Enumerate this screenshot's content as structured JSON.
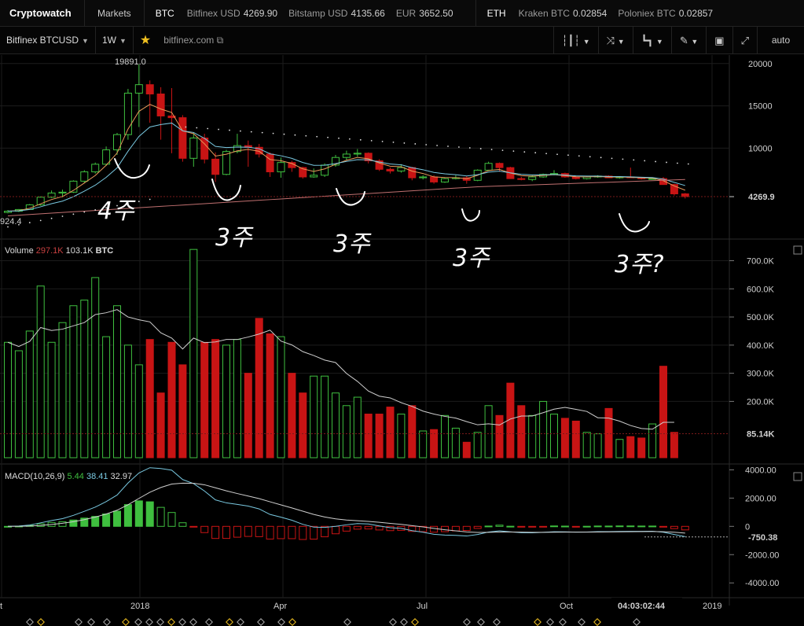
{
  "app": {
    "brand": "Cryptowatch",
    "markets": "Markets"
  },
  "ticker": {
    "btc": {
      "symbol": "BTC",
      "items": [
        {
          "label": "Bitfinex USD",
          "value": "4269.90"
        },
        {
          "label": "Bitstamp USD",
          "value": "4135.66"
        },
        {
          "label": "EUR",
          "value": "3652.50"
        }
      ]
    },
    "eth": {
      "symbol": "ETH",
      "items": [
        {
          "label": "Kraken BTC",
          "value": "0.02854"
        },
        {
          "label": "Poloniex BTC",
          "value": "0.02857"
        }
      ]
    }
  },
  "toolbar": {
    "market": "Bitfinex BTCUSD",
    "period": "1W",
    "host": "bitfinex.com",
    "auto": "auto"
  },
  "price_pane": {
    "y_ticks": [
      "20000",
      "15000",
      "10000"
    ],
    "last_price": "4269.9",
    "high_label": "19891.0",
    "low_label": "924.4"
  },
  "volume_pane": {
    "title": "Volume",
    "current": "297.1K",
    "avg": "103.1K",
    "unit": "BTC",
    "y_ticks": [
      "700.0K",
      "600.0K",
      "500.0K",
      "400.0K",
      "300.0K",
      "200.0K"
    ],
    "last_value": "85.14K"
  },
  "macd_pane": {
    "title": "MACD(10,26,9)",
    "v1": "5.44",
    "v2": "38.41",
    "v3": "32.97",
    "y_ticks": [
      "4000.00",
      "2000.00",
      "0",
      "-2000.00",
      "-4000.00"
    ],
    "last_value": "-750.38"
  },
  "time_axis": {
    "labels": [
      "t",
      "2018",
      "Apr",
      "Jul",
      "Oct",
      "2019"
    ],
    "cursor_time": "04:03:02:44"
  },
  "annotations": [
    "4주",
    "3주",
    "3주",
    "3주",
    "3주?"
  ],
  "colors": {
    "up": "#3fbf3f",
    "down": "#c81414",
    "ema_fast": "#e89a5a",
    "ema_slow": "#79c8e0",
    "sma_long": "#c07070",
    "accent": "#f0c020"
  },
  "chart_data": {
    "type": "candlestick",
    "candles_ohlc": [
      [
        2400,
        2700,
        2300,
        2550
      ],
      [
        2550,
        2800,
        2450,
        2750
      ],
      [
        2750,
        3400,
        2700,
        3300
      ],
      [
        3300,
        4300,
        3200,
        4200
      ],
      [
        4200,
        5000,
        4100,
        4700
      ],
      [
        4700,
        5100,
        4200,
        4800
      ],
      [
        4800,
        6200,
        4700,
        6100
      ],
      [
        6100,
        7400,
        5900,
        7200
      ],
      [
        7200,
        8300,
        7000,
        8100
      ],
      [
        8100,
        10200,
        7900,
        9800
      ],
      [
        9800,
        11800,
        9200,
        11600
      ],
      [
        11600,
        17000,
        11000,
        16500
      ],
      [
        16500,
        19891,
        12500,
        17500
      ],
      [
        17500,
        18000,
        13000,
        16400
      ],
      [
        16400,
        17200,
        11000,
        13800
      ],
      [
        13800,
        17100,
        9400,
        13600
      ],
      [
        13600,
        13900,
        8400,
        8800
      ],
      [
        8800,
        11800,
        7800,
        11200
      ],
      [
        11200,
        11700,
        8200,
        8700
      ],
      [
        8700,
        9500,
        6000,
        6900
      ],
      [
        6900,
        9800,
        6800,
        9600
      ],
      [
        9600,
        11700,
        9400,
        10300
      ],
      [
        10300,
        10900,
        7800,
        10100
      ],
      [
        10100,
        10500,
        8900,
        9300
      ],
      [
        9300,
        9500,
        6600,
        7200
      ],
      [
        7200,
        8900,
        6500,
        8300
      ],
      [
        8300,
        8500,
        7200,
        7700
      ],
      [
        7700,
        7800,
        6400,
        6600
      ],
      [
        6600,
        7600,
        6500,
        6800
      ],
      [
        6800,
        8200,
        6600,
        8000
      ],
      [
        8000,
        9200,
        7800,
        8900
      ],
      [
        8900,
        9700,
        8600,
        9300
      ],
      [
        9300,
        9900,
        9000,
        9400
      ],
      [
        9400,
        9500,
        8200,
        8500
      ],
      [
        8500,
        8700,
        7300,
        7500
      ],
      [
        7500,
        7700,
        7000,
        7300
      ],
      [
        7300,
        8100,
        7100,
        7700
      ],
      [
        7700,
        7800,
        6200,
        6500
      ],
      [
        6500,
        6800,
        6300,
        6600
      ],
      [
        6600,
        6800,
        5800,
        6000
      ],
      [
        6000,
        6500,
        5900,
        6400
      ],
      [
        6400,
        6800,
        6300,
        6500
      ],
      [
        6500,
        6700,
        5800,
        6200
      ],
      [
        6200,
        7500,
        6100,
        7400
      ],
      [
        7400,
        8400,
        7300,
        8200
      ],
      [
        8200,
        8300,
        7200,
        7700
      ],
      [
        7700,
        7800,
        6400,
        6400
      ],
      [
        6400,
        6600,
        6200,
        6300
      ],
      [
        6300,
        6800,
        6100,
        6600
      ],
      [
        6600,
        7000,
        6500,
        6900
      ],
      [
        6900,
        7400,
        6800,
        7000
      ],
      [
        7000,
        7100,
        6500,
        6600
      ],
      [
        6600,
        6700,
        6300,
        6400
      ],
      [
        6400,
        6700,
        6300,
        6600
      ],
      [
        6600,
        6800,
        6500,
        6700
      ],
      [
        6700,
        6800,
        6500,
        6500
      ],
      [
        6500,
        6700,
        6400,
        6600
      ],
      [
        6600,
        7700,
        6500,
        6500
      ],
      [
        6500,
        6600,
        6300,
        6400
      ],
      [
        6400,
        6500,
        6300,
        6400
      ],
      [
        6400,
        6600,
        5700,
        5700
      ],
      [
        5700,
        5800,
        4400,
        4600
      ],
      [
        4600,
        4700,
        4050,
        4270
      ]
    ],
    "volumes_k": [
      410,
      380,
      450,
      610,
      410,
      480,
      540,
      560,
      640,
      430,
      540,
      400,
      330,
      420,
      230,
      410,
      330,
      740,
      410,
      420,
      400,
      420,
      300,
      495,
      440,
      430,
      300,
      230,
      290,
      290,
      230,
      185,
      215,
      155,
      155,
      180,
      155,
      185,
      95,
      100,
      150,
      105,
      55,
      90,
      185,
      150,
      265,
      185,
      150,
      200,
      155,
      140,
      130,
      90,
      85,
      175,
      65,
      75,
      70,
      120,
      325,
      90
    ],
    "ylim_price": [
      0,
      21000
    ],
    "ylim_volume_k": [
      0,
      760
    ],
    "ylim_macd": [
      -4600,
      4300
    ]
  }
}
